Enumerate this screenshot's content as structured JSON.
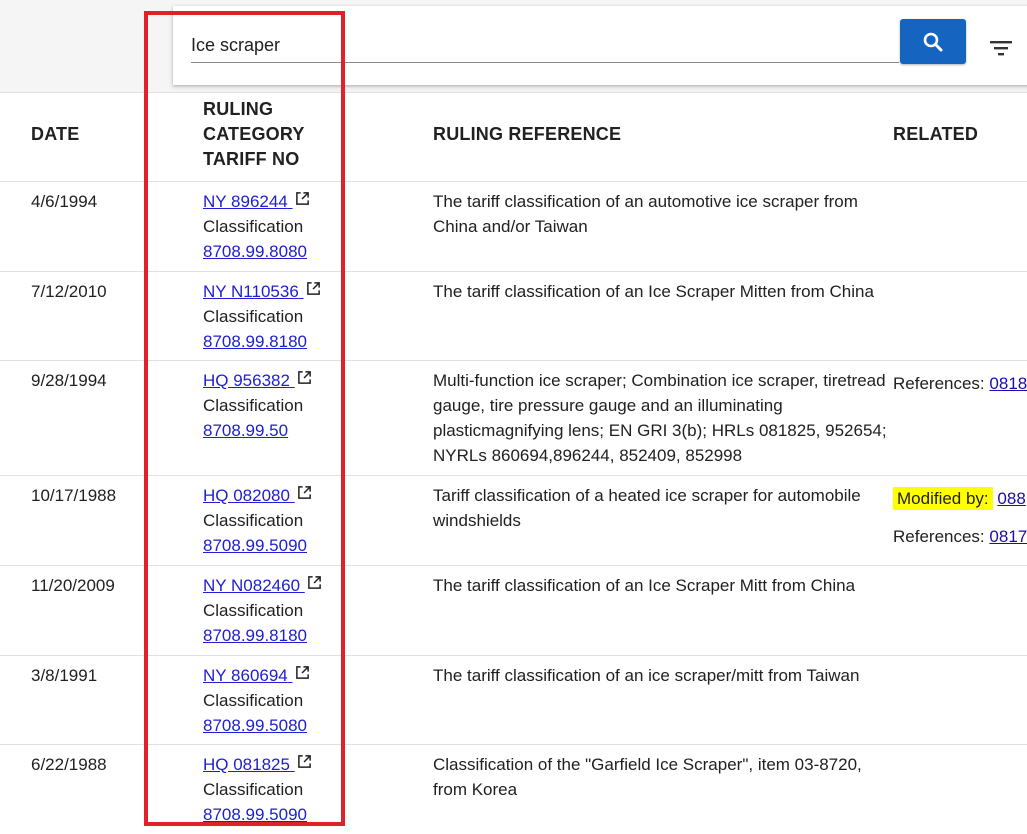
{
  "search": {
    "value": "Ice scraper",
    "button_icon": "search-icon",
    "filter_icon": "filter-icon"
  },
  "colors": {
    "accent": "#1565c0",
    "link": "#1e1ed2",
    "highlight": "#ffff00",
    "annotation_box": "#e0202a"
  },
  "table": {
    "headers": {
      "date": "DATE",
      "ruling_line1": "RULING",
      "ruling_line2": "CATEGORY",
      "ruling_line3": "TARIFF NO",
      "reference": "RULING REFERENCE",
      "related": "RELATED"
    },
    "rows": [
      {
        "date": "4/6/1994",
        "ruling": "NY 896244",
        "category": "Classification",
        "tariff": "8708.99.8080",
        "reference": "The tariff classification of an automotive ice scraper from China and/or Taiwan",
        "related": []
      },
      {
        "date": "7/12/2010",
        "ruling": "NY N110536",
        "category": "Classification",
        "tariff": "8708.99.8180",
        "reference": "The tariff classification of an Ice Scraper Mitten from China",
        "related": []
      },
      {
        "date": "9/28/1994",
        "ruling": "HQ 956382",
        "category": "Classification",
        "tariff": "8708.99.50",
        "reference": "Multi-function ice scraper; Combination ice scraper, tiretread gauge, tire pressure gauge and an illuminating plasticmagnifying lens; EN GRI 3(b); HRLs 081825, 952654; NYRLs 860694,896244, 852409, 852998",
        "related": [
          {
            "label": "References:",
            "link": "0818",
            "highlight": false
          }
        ]
      },
      {
        "date": "10/17/1988",
        "ruling": "HQ 082080",
        "category": "Classification",
        "tariff": "8708.99.5090",
        "reference": "Tariff classification of a heated ice scraper for automobile windshields",
        "related": [
          {
            "label": "Modified by:",
            "link": "088",
            "highlight": true
          },
          {
            "label": "References:",
            "link": "0817",
            "highlight": false
          }
        ]
      },
      {
        "date": "11/20/2009",
        "ruling": "NY N082460",
        "category": "Classification",
        "tariff": "8708.99.8180",
        "reference": "The tariff classification of an Ice Scraper Mitt from China",
        "related": []
      },
      {
        "date": "3/8/1991",
        "ruling": "NY 860694",
        "category": "Classification",
        "tariff": "8708.99.5080",
        "reference": "The tariff classification of an ice scraper/mitt from Taiwan",
        "related": []
      },
      {
        "date": "6/22/1988",
        "ruling": "HQ 081825",
        "category": "Classification",
        "tariff": "8708.99.5090",
        "reference": "Classification of the \"Garfield Ice Scraper\", item 03-8720, from Korea",
        "related": []
      }
    ]
  }
}
